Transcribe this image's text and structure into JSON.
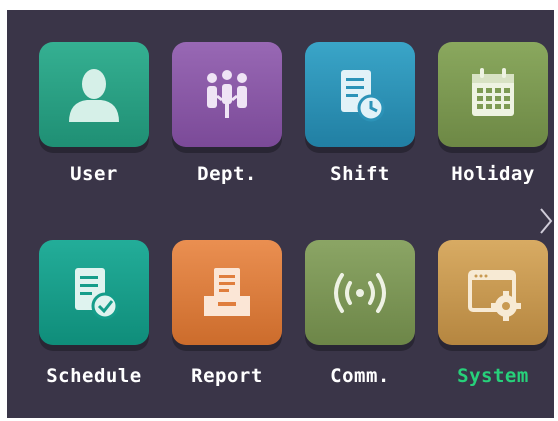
{
  "menu": {
    "items": [
      {
        "label": "User",
        "icon": "user-icon",
        "color": "#2aa083"
      },
      {
        "label": "Dept.",
        "icon": "department-icon",
        "color": "#8b5aa6"
      },
      {
        "label": "Shift",
        "icon": "shift-icon",
        "color": "#2c93b8"
      },
      {
        "label": "Holiday",
        "icon": "calendar-icon",
        "color": "#7d9a52"
      },
      {
        "label": "Schedule",
        "icon": "schedule-icon",
        "color": "#159d8a"
      },
      {
        "label": "Report",
        "icon": "report-icon",
        "color": "#e07e3d"
      },
      {
        "label": "Comm.",
        "icon": "wireless-icon",
        "color": "#7d9456"
      },
      {
        "label": "System",
        "icon": "system-settings-icon",
        "color": "#c99a52"
      }
    ],
    "selected": "System",
    "selected_color": "#27d07a",
    "next_page_icon": "chevron-right-icon"
  }
}
